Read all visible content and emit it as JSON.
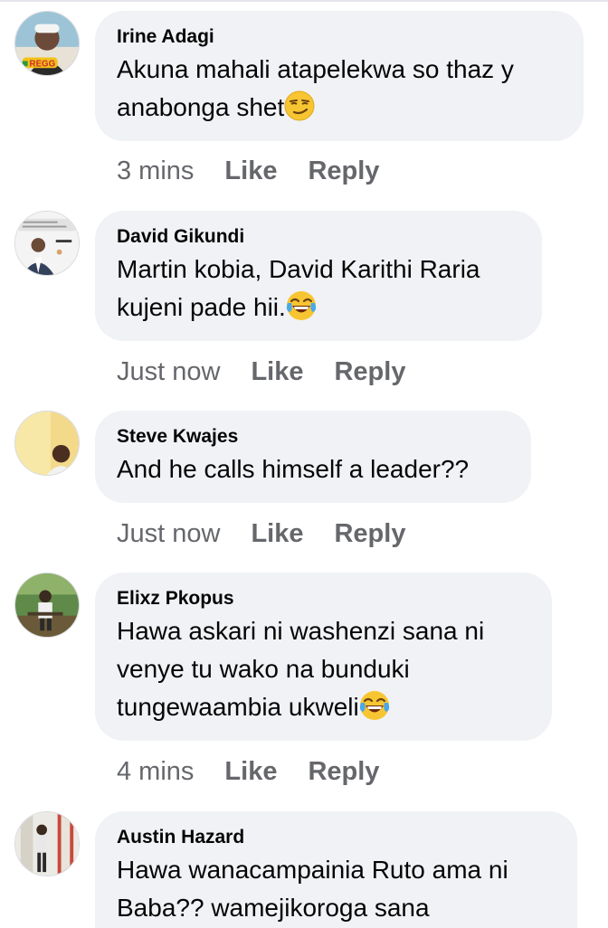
{
  "comments": [
    {
      "author": "Irine Adagi",
      "text": "Akuna mahali atapelekwa so thaz y anabonga shet",
      "emoji": "smirk",
      "time": "3 mins",
      "like_label": "Like",
      "reply_label": "Reply"
    },
    {
      "author": "David Gikundi",
      "text": "Martin kobia, David Karithi Raria kujeni pade hii.",
      "emoji": "laugh-tears",
      "time": "Just now",
      "like_label": "Like",
      "reply_label": "Reply"
    },
    {
      "author": "Steve Kwajes",
      "text": "And he calls himself a leader??",
      "emoji": "",
      "time": "Just now",
      "like_label": "Like",
      "reply_label": "Reply"
    },
    {
      "author": "Elixz Pkopus",
      "text": "Hawa askari ni washenzi sana ni venye tu wako na bunduki tungewaambia ukweli",
      "emoji": "laugh-tears",
      "time": "4 mins",
      "like_label": "Like",
      "reply_label": "Reply"
    },
    {
      "author": "Austin Hazard",
      "text": "Hawa wanacampainia Ruto ama ni Baba?? wamejikoroga sana",
      "emoji": "",
      "time": "",
      "like_label": "",
      "reply_label": ""
    }
  ],
  "colors": {
    "bubble": "#f0f2f5",
    "meta": "#65676b",
    "text": "#050505"
  }
}
